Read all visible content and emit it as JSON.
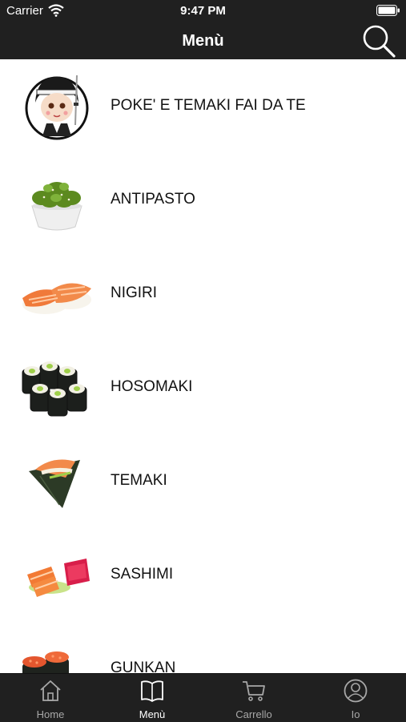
{
  "status_bar": {
    "carrier": "Carrier",
    "time": "9:47 PM"
  },
  "header": {
    "title": "Menù",
    "search_icon": "search-icon"
  },
  "menu": {
    "items": [
      {
        "label": "POKE' E TEMAKI FAI DA TE",
        "image": "chef-mascot"
      },
      {
        "label": "ANTIPASTO",
        "image": "seaweed-salad-bowl"
      },
      {
        "label": "NIGIRI",
        "image": "salmon-nigiri"
      },
      {
        "label": "HOSOMAKI",
        "image": "hosomaki-rolls"
      },
      {
        "label": "TEMAKI",
        "image": "temaki-cone"
      },
      {
        "label": "SASHIMI",
        "image": "sashimi-slices"
      },
      {
        "label": "GUNKAN",
        "image": "gunkan-pieces"
      }
    ]
  },
  "tabbar": {
    "tabs": [
      {
        "label": "Home",
        "icon": "home-icon",
        "active": false
      },
      {
        "label": "Menù",
        "icon": "book-icon",
        "active": true
      },
      {
        "label": "Carrello",
        "icon": "cart-icon",
        "active": false
      },
      {
        "label": "Io",
        "icon": "user-icon",
        "active": false
      }
    ]
  },
  "colors": {
    "bar_background": "#202020",
    "active_tab": "#ffffff",
    "inactive_tab": "#a8a8a8"
  }
}
